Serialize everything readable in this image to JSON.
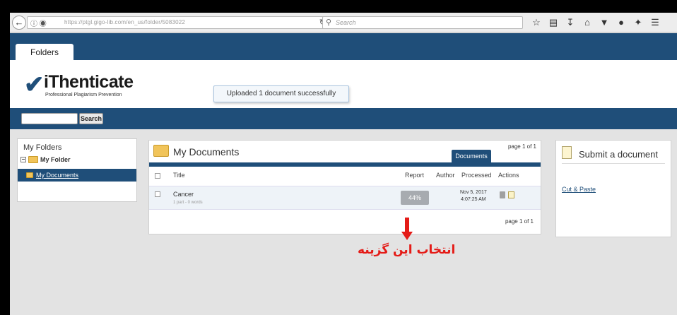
{
  "browser": {
    "back_icon": "back-arrow-icon",
    "url": "https://ptgl.gigo-lib.com/en_us/folder/5083022",
    "search_placeholder": "Search",
    "toolbar_icons": [
      "star-icon",
      "reading-list-icon",
      "download-icon",
      "home-icon",
      "pocket-icon",
      "extension-icon",
      "menu-icon"
    ]
  },
  "header": {
    "tab_label": "Folders",
    "logo_name": "iThenticate",
    "logo_tagline": "Professional Plagiarism Prevention",
    "toast": "Uploaded 1 document successfully"
  },
  "nav": {
    "search_button": "Search"
  },
  "sidebar": {
    "title": "My Folders",
    "folder": "My Folder",
    "active_item": "My Documents"
  },
  "documents": {
    "title": "My Documents",
    "page_top": "page 1 of 1",
    "tab": "Documents",
    "columns": {
      "title": "Title",
      "report": "Report",
      "author": "Author",
      "processed": "Processed",
      "actions": "Actions"
    },
    "rows": [
      {
        "title": "Cancer",
        "subtitle": "1 part - 0 words",
        "report": "44%",
        "processed_date": "Nov 5, 2017",
        "processed_time": "4:07:25 AM"
      }
    ],
    "page_bottom": "page 1 of 1"
  },
  "submit": {
    "title": "Submit a document",
    "link": "Cut & Paste"
  },
  "annotation": {
    "text": "انتخاب این گزینه",
    "color": "#e41b17"
  },
  "colors": {
    "brand": "#1f4e79",
    "badge": "#a7abb0"
  }
}
